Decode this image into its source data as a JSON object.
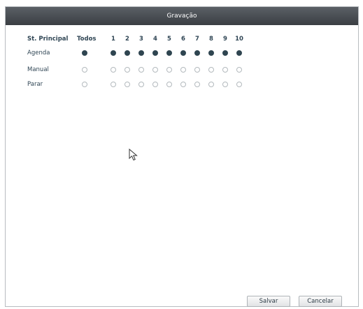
{
  "window": {
    "title": "Gravação"
  },
  "table": {
    "row_header": "St. Principal",
    "all_label": "Todos",
    "channels": [
      "1",
      "2",
      "3",
      "4",
      "5",
      "6",
      "7",
      "8",
      "9",
      "10"
    ],
    "rows": [
      {
        "label": "Agenda",
        "all_selected": true,
        "selected": [
          true,
          true,
          true,
          true,
          true,
          true,
          true,
          true,
          true,
          true
        ]
      },
      {
        "label": "Manual",
        "all_selected": false,
        "selected": [
          false,
          false,
          false,
          false,
          false,
          false,
          false,
          false,
          false,
          false
        ]
      },
      {
        "label": "Parar",
        "all_selected": false,
        "selected": [
          false,
          false,
          false,
          false,
          false,
          false,
          false,
          false,
          false,
          false
        ]
      }
    ]
  },
  "buttons": {
    "save_label": "Salvar",
    "cancel_label": "Cancelar"
  },
  "colors": {
    "titlebar": "#3f4348",
    "radio_selected": "#2f4550",
    "radio_border": "#b3b9bd"
  },
  "icons": {
    "cursor": "mouse-pointer-icon"
  }
}
